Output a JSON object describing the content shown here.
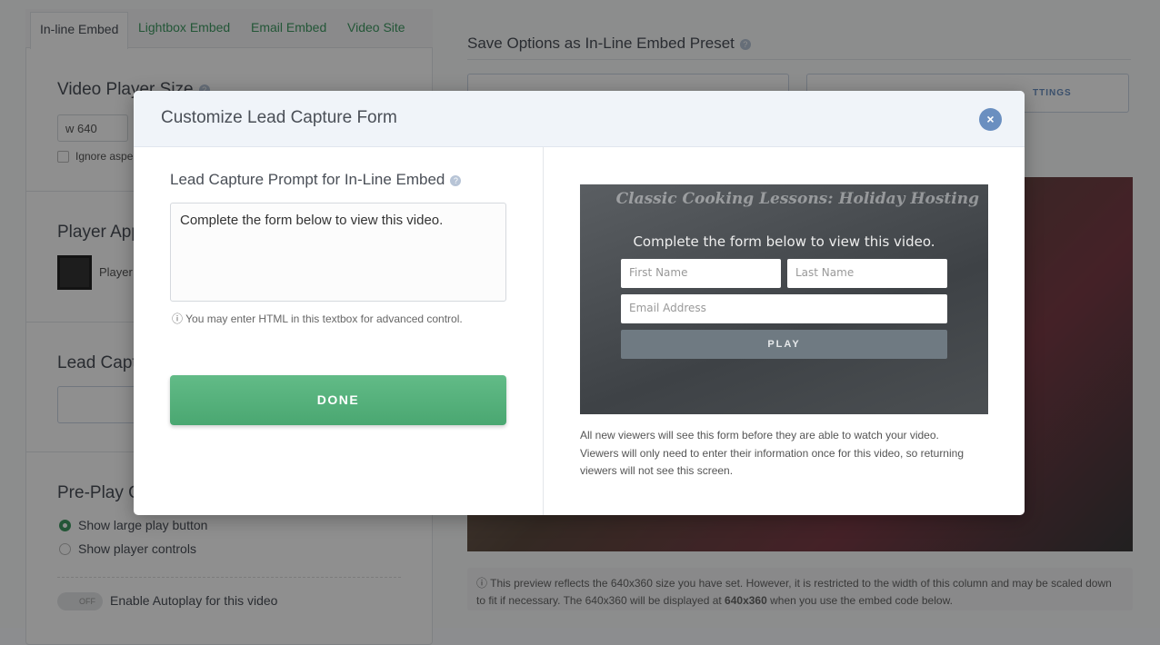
{
  "tabs": [
    "In-line Embed",
    "Lightbox Embed",
    "Email Embed",
    "Video Site"
  ],
  "left": {
    "player_size_title": "Video Player Size",
    "width_value": "w 640",
    "ignore_aspect": "Ignore aspe",
    "player_appearance_title": "Player App",
    "player_label": "Player",
    "lead_capture_title": "Lead Captu",
    "preplay_title": "Pre-Play O",
    "radio_large_play": "Show large play button",
    "radio_controls": "Show player controls",
    "autoplay_toggle": "OFF",
    "autoplay_label": "Enable Autoplay for this video"
  },
  "right": {
    "preset_title": "Save Options as In-Line Embed Preset",
    "button2_label": "TTINGS",
    "preview_note_1": "This preview reflects the 640x360 size you have set. However, it is restricted to the width of this column and may be scaled down to fit if necessary. The 640x360 will be displayed at ",
    "preview_note_bold": "640x360",
    "preview_note_2": " when you use the embed code below."
  },
  "modal": {
    "title": "Customize Lead Capture Form",
    "prompt_label": "Lead Capture Prompt for In-Line Embed",
    "prompt_value": "Complete the form below to view this video.",
    "hint": "You may enter HTML in this textbox for advanced control.",
    "done": "DONE",
    "preview": {
      "video_title": "Classic Cooking Lessons: Holiday Hosting",
      "prompt": "Complete the form below to view this video.",
      "first_name": "First Name",
      "last_name": "Last Name",
      "email": "Email Address",
      "play": "PLAY"
    },
    "description": "All new viewers will see this form before they are able to watch your video. Viewers will only need to enter their information once for this video, so returning viewers will not see this screen."
  },
  "colors": {
    "accent": "#3f9a62",
    "close": "#6a8fc0"
  }
}
